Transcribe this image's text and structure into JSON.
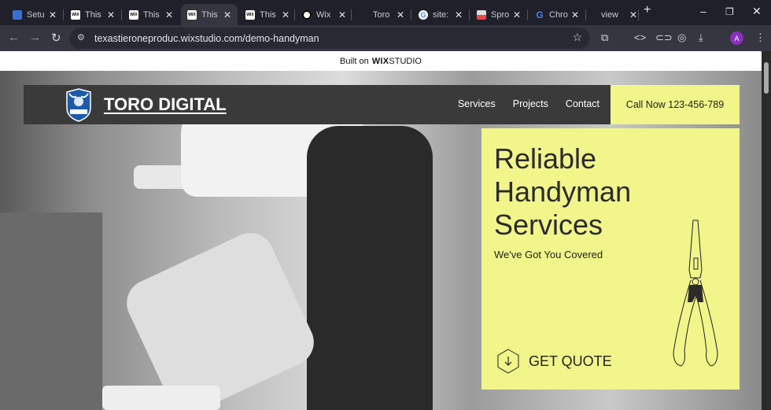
{
  "browser": {
    "tabs": [
      {
        "label": "Setu",
        "favicon": "shield"
      },
      {
        "label": "This",
        "favicon": "wix"
      },
      {
        "label": "This",
        "favicon": "wix"
      },
      {
        "label": "This",
        "favicon": "wix",
        "active": true
      },
      {
        "label": "This",
        "favicon": "wix"
      },
      {
        "label": "Wix",
        "favicon": "circle"
      },
      {
        "label": "Toro",
        "favicon": "none"
      },
      {
        "label": "site:",
        "favicon": "google"
      },
      {
        "label": "Spro",
        "favicon": "sprout"
      },
      {
        "label": "Chro",
        "favicon": "google"
      },
      {
        "label": "view",
        "favicon": "none"
      }
    ],
    "favicon_wix_text": "WIX",
    "url": "texastieroneproduc.wixstudio.com/demo-handyman",
    "profile_initial": "A"
  },
  "wix_banner": {
    "prefix": "Built on",
    "brand_bold": "WIX",
    "brand_light": "STUDIO"
  },
  "site": {
    "brand": "TORO DIGITAL",
    "logo_text": "TORO DIGITAL",
    "nav": [
      "Services",
      "Projects",
      "Contact"
    ],
    "call": "Call Now 123-456-789",
    "hero_title": "Reliable Handyman Services",
    "hero_subtitle": "We've Got You Covered",
    "cta": "GET QUOTE",
    "accent": "#f1f58a"
  }
}
